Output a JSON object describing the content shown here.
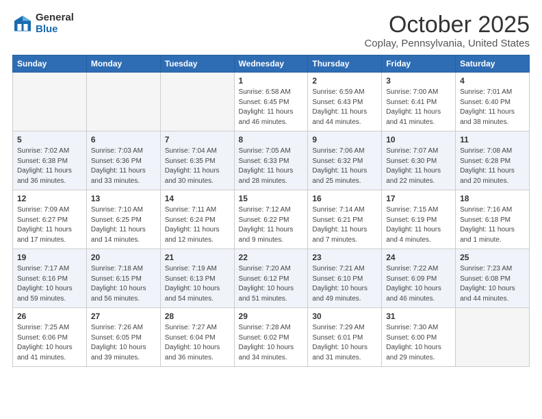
{
  "header": {
    "logo_general": "General",
    "logo_blue": "Blue",
    "month": "October 2025",
    "location": "Coplay, Pennsylvania, United States"
  },
  "days_of_week": [
    "Sunday",
    "Monday",
    "Tuesday",
    "Wednesday",
    "Thursday",
    "Friday",
    "Saturday"
  ],
  "weeks": [
    [
      {
        "day": "",
        "info": ""
      },
      {
        "day": "",
        "info": ""
      },
      {
        "day": "",
        "info": ""
      },
      {
        "day": "1",
        "info": "Sunrise: 6:58 AM\nSunset: 6:45 PM\nDaylight: 11 hours\nand 46 minutes."
      },
      {
        "day": "2",
        "info": "Sunrise: 6:59 AM\nSunset: 6:43 PM\nDaylight: 11 hours\nand 44 minutes."
      },
      {
        "day": "3",
        "info": "Sunrise: 7:00 AM\nSunset: 6:41 PM\nDaylight: 11 hours\nand 41 minutes."
      },
      {
        "day": "4",
        "info": "Sunrise: 7:01 AM\nSunset: 6:40 PM\nDaylight: 11 hours\nand 38 minutes."
      }
    ],
    [
      {
        "day": "5",
        "info": "Sunrise: 7:02 AM\nSunset: 6:38 PM\nDaylight: 11 hours\nand 36 minutes."
      },
      {
        "day": "6",
        "info": "Sunrise: 7:03 AM\nSunset: 6:36 PM\nDaylight: 11 hours\nand 33 minutes."
      },
      {
        "day": "7",
        "info": "Sunrise: 7:04 AM\nSunset: 6:35 PM\nDaylight: 11 hours\nand 30 minutes."
      },
      {
        "day": "8",
        "info": "Sunrise: 7:05 AM\nSunset: 6:33 PM\nDaylight: 11 hours\nand 28 minutes."
      },
      {
        "day": "9",
        "info": "Sunrise: 7:06 AM\nSunset: 6:32 PM\nDaylight: 11 hours\nand 25 minutes."
      },
      {
        "day": "10",
        "info": "Sunrise: 7:07 AM\nSunset: 6:30 PM\nDaylight: 11 hours\nand 22 minutes."
      },
      {
        "day": "11",
        "info": "Sunrise: 7:08 AM\nSunset: 6:28 PM\nDaylight: 11 hours\nand 20 minutes."
      }
    ],
    [
      {
        "day": "12",
        "info": "Sunrise: 7:09 AM\nSunset: 6:27 PM\nDaylight: 11 hours\nand 17 minutes."
      },
      {
        "day": "13",
        "info": "Sunrise: 7:10 AM\nSunset: 6:25 PM\nDaylight: 11 hours\nand 14 minutes."
      },
      {
        "day": "14",
        "info": "Sunrise: 7:11 AM\nSunset: 6:24 PM\nDaylight: 11 hours\nand 12 minutes."
      },
      {
        "day": "15",
        "info": "Sunrise: 7:12 AM\nSunset: 6:22 PM\nDaylight: 11 hours\nand 9 minutes."
      },
      {
        "day": "16",
        "info": "Sunrise: 7:14 AM\nSunset: 6:21 PM\nDaylight: 11 hours\nand 7 minutes."
      },
      {
        "day": "17",
        "info": "Sunrise: 7:15 AM\nSunset: 6:19 PM\nDaylight: 11 hours\nand 4 minutes."
      },
      {
        "day": "18",
        "info": "Sunrise: 7:16 AM\nSunset: 6:18 PM\nDaylight: 11 hours\nand 1 minute."
      }
    ],
    [
      {
        "day": "19",
        "info": "Sunrise: 7:17 AM\nSunset: 6:16 PM\nDaylight: 10 hours\nand 59 minutes."
      },
      {
        "day": "20",
        "info": "Sunrise: 7:18 AM\nSunset: 6:15 PM\nDaylight: 10 hours\nand 56 minutes."
      },
      {
        "day": "21",
        "info": "Sunrise: 7:19 AM\nSunset: 6:13 PM\nDaylight: 10 hours\nand 54 minutes."
      },
      {
        "day": "22",
        "info": "Sunrise: 7:20 AM\nSunset: 6:12 PM\nDaylight: 10 hours\nand 51 minutes."
      },
      {
        "day": "23",
        "info": "Sunrise: 7:21 AM\nSunset: 6:10 PM\nDaylight: 10 hours\nand 49 minutes."
      },
      {
        "day": "24",
        "info": "Sunrise: 7:22 AM\nSunset: 6:09 PM\nDaylight: 10 hours\nand 46 minutes."
      },
      {
        "day": "25",
        "info": "Sunrise: 7:23 AM\nSunset: 6:08 PM\nDaylight: 10 hours\nand 44 minutes."
      }
    ],
    [
      {
        "day": "26",
        "info": "Sunrise: 7:25 AM\nSunset: 6:06 PM\nDaylight: 10 hours\nand 41 minutes."
      },
      {
        "day": "27",
        "info": "Sunrise: 7:26 AM\nSunset: 6:05 PM\nDaylight: 10 hours\nand 39 minutes."
      },
      {
        "day": "28",
        "info": "Sunrise: 7:27 AM\nSunset: 6:04 PM\nDaylight: 10 hours\nand 36 minutes."
      },
      {
        "day": "29",
        "info": "Sunrise: 7:28 AM\nSunset: 6:02 PM\nDaylight: 10 hours\nand 34 minutes."
      },
      {
        "day": "30",
        "info": "Sunrise: 7:29 AM\nSunset: 6:01 PM\nDaylight: 10 hours\nand 31 minutes."
      },
      {
        "day": "31",
        "info": "Sunrise: 7:30 AM\nSunset: 6:00 PM\nDaylight: 10 hours\nand 29 minutes."
      },
      {
        "day": "",
        "info": ""
      }
    ]
  ]
}
